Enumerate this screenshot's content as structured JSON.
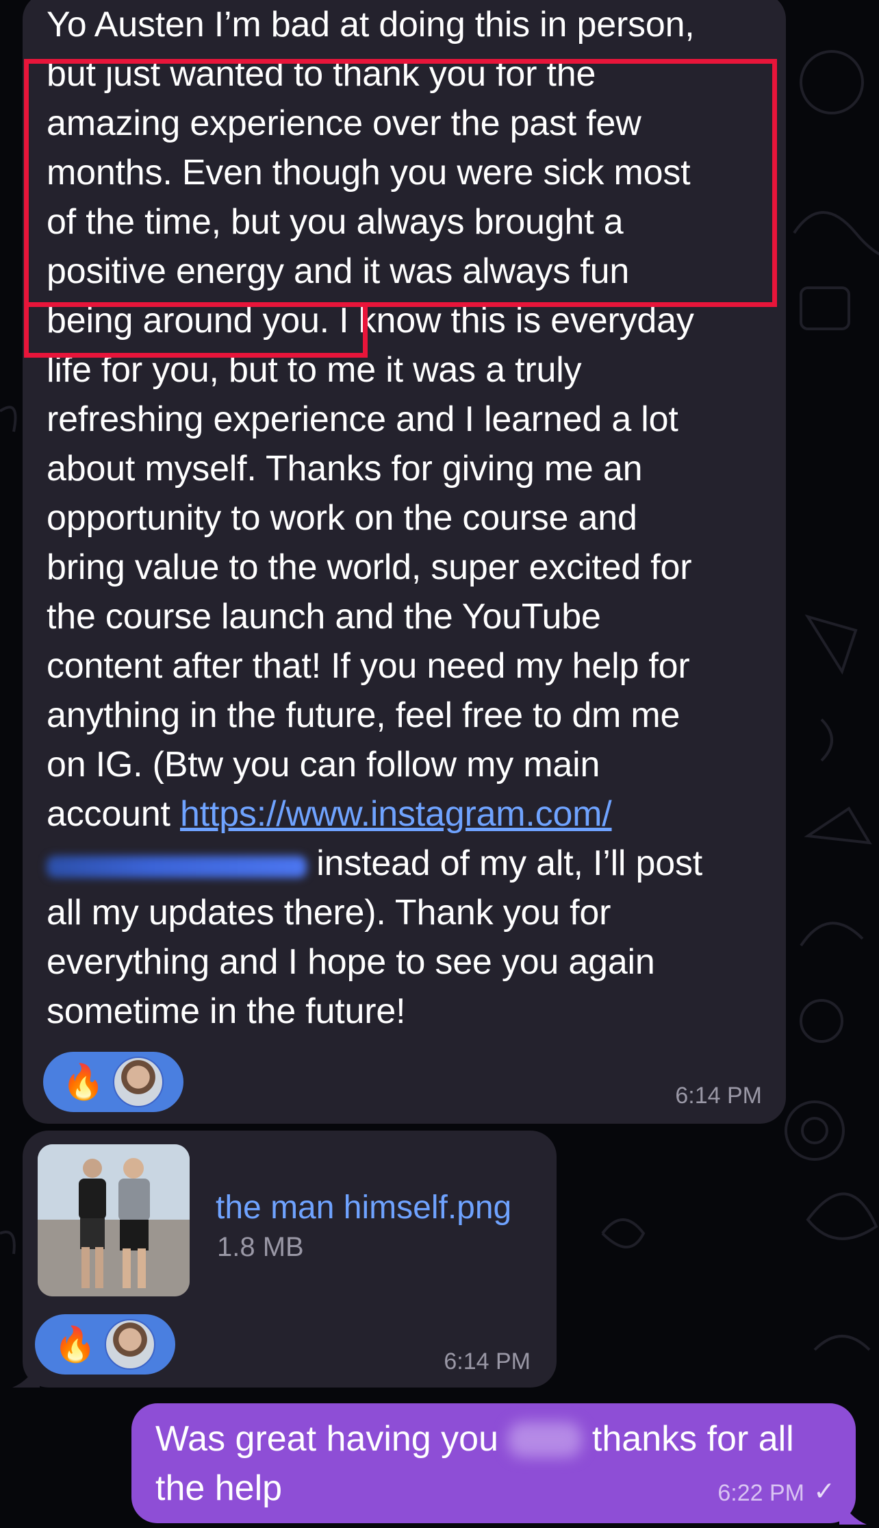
{
  "messages": [
    {
      "id": "incoming-long",
      "text_part1": "Yo Austen I’m bad at doing this in person,\nbut just wanted to thank you for the\namazing experience over the past few\nmonths. Even though you were sick most\nof the time, but you always brought a\npositive energy and it was always fun\nbeing around you. I know this is everyday\nlife for you, but to me it was a truly\nrefreshing experience and I learned a lot\nabout myself. Thanks for giving me an\nopportunity to work on the course and\nbring value to the world, super excited for\nthe course launch and the YouTube\ncontent after that! If you need my help for\nanything in the future, feel free to dm me\non IG. (Btw you can follow my main\naccount ",
      "link": "https://www.instagram.com/",
      "text_part2": " instead of my alt, I’ll post\nall my updates there). Thank you for\neverything and I hope to see you again\nsometime in the future!",
      "reaction_emoji": "🔥",
      "time": "6:14 PM"
    },
    {
      "id": "incoming-file",
      "file_name": "the man himself.png",
      "file_size": "1.8 MB",
      "reaction_emoji": "🔥",
      "time": "6:14 PM"
    },
    {
      "id": "outgoing",
      "text_part1": "Was great having you ",
      "text_part2": " thanks for all\nthe help",
      "time": "6:22 PM",
      "status": "✓"
    }
  ],
  "colors": {
    "incoming_bubble": "#24222d",
    "outgoing_bubble": "#8e4ed6",
    "link": "#6fa3ff",
    "reaction": "#4a7fe0",
    "highlight": "#e8153a"
  },
  "icons": [
    "fire-icon",
    "avatar",
    "image-thumbnail",
    "read-check-icon"
  ]
}
